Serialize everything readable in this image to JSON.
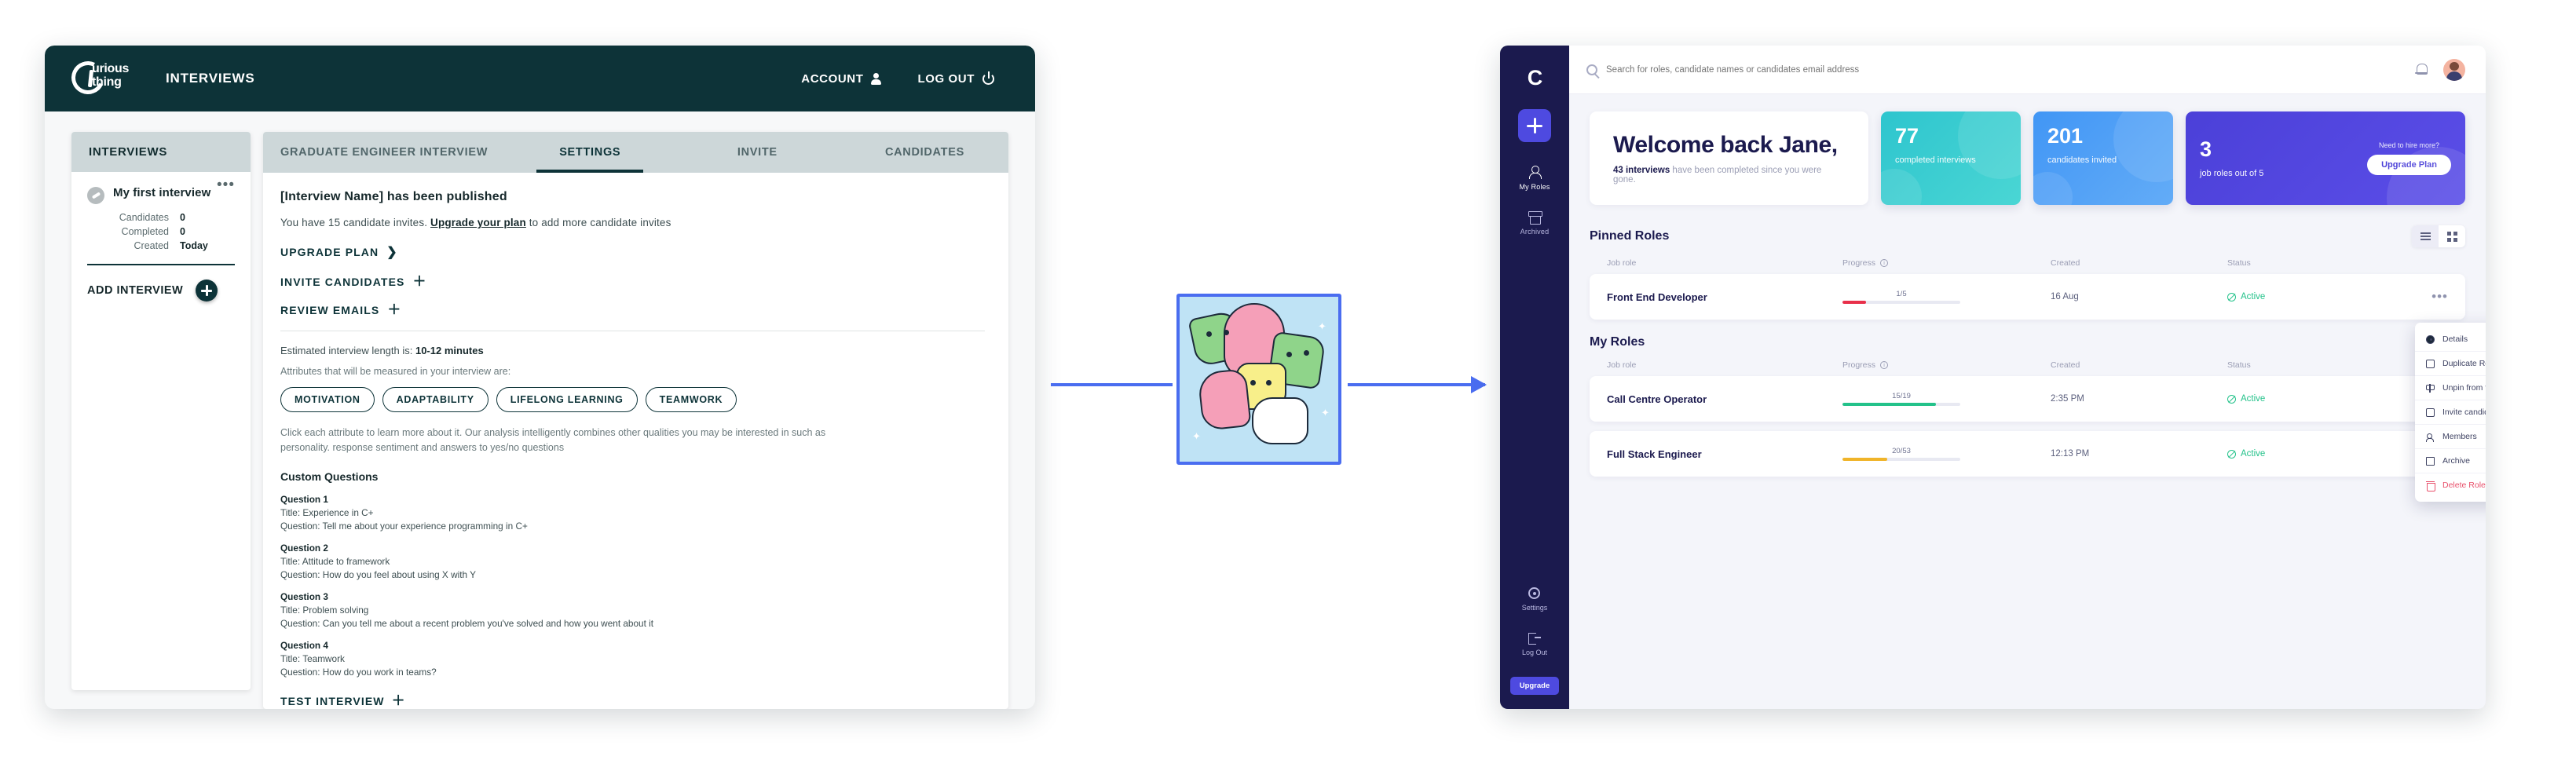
{
  "left_app": {
    "brand": {
      "line1": "urious",
      "line2": "thing"
    },
    "nav_label": "INTERVIEWS",
    "account_label": "ACCOUNT",
    "logout_label": "LOG OUT",
    "sidebar": {
      "header": "INTERVIEWS",
      "interview": {
        "title": "My first interview",
        "more_glyph": "•••",
        "meta": [
          {
            "label": "Candidates",
            "value": "0"
          },
          {
            "label": "Completed",
            "value": "0"
          },
          {
            "label": "Created",
            "value": "Today"
          }
        ]
      },
      "add_label": "ADD INTERVIEW"
    },
    "tabs": [
      {
        "label": "GRADUATE ENGINEER INTERVIEW",
        "active": false
      },
      {
        "label": "SETTINGS",
        "active": true
      },
      {
        "label": "INVITE",
        "active": false
      },
      {
        "label": "CANDIDATES",
        "active": false
      }
    ],
    "main": {
      "published_heading": "[Interview Name] has been published",
      "invites_prefix": "You have 15 candidate invites. ",
      "invites_link": "Upgrade your plan",
      "invites_suffix": " to add more candidate invites",
      "upgrade_plan_label": "UPGRADE PLAN",
      "upgrade_plan_chevron": "❯",
      "invite_candidates_label": "INVITE CANDIDATES",
      "review_emails_label": "REVIEW EMAILS",
      "plus_glyph": "＋",
      "length_prefix": "Estimated interview length is: ",
      "length_value": "10-12 minutes",
      "attributes_lead": "Attributes that will be measured in your interview are:",
      "attributes": [
        "MOTIVATION",
        "ADAPTABILITY",
        "LIFELONG LEARNING",
        "TEAMWORK"
      ],
      "attributes_note": "Click each attribute to learn more about it. Our analysis intelligently combines other qualities you may be interested in such as personality. response sentiment and answers to yes/no questions",
      "custom_questions_heading": "Custom Questions",
      "questions": [
        {
          "n": "Question 1",
          "title": "Title: Experience in C+",
          "q": "Question: Tell me about your experience programming in C+"
        },
        {
          "n": "Question 2",
          "title": "Title: Attitude to framework",
          "q": "Question: How do you feel about using X with Y"
        },
        {
          "n": "Question 3",
          "title": "Title: Problem solving",
          "q": "Question: Can you tell me about a recent problem you've solved and how you went about it"
        },
        {
          "n": "Question 4",
          "title": "Title: Teamwork",
          "q": "Question: How do you work in teams?"
        }
      ],
      "test_interview_label": "TEST INTERVIEW"
    }
  },
  "right_app": {
    "logo": "C",
    "sidebar": {
      "add_glyph": "+",
      "items": [
        {
          "label": "My Roles",
          "icon": "people-icon",
          "active": true
        },
        {
          "label": "Archived",
          "icon": "archive-icon",
          "active": false
        }
      ],
      "bottom_items": [
        {
          "label": "Settings",
          "icon": "gear-icon"
        },
        {
          "label": "Log Out",
          "icon": "logout-icon"
        }
      ],
      "upgrade_label": "Upgrade"
    },
    "topbar": {
      "search_placeholder": "Search for roles, candidate names or candidates email address"
    },
    "welcome": {
      "title": "Welcome back Jane,",
      "sub_bold": "43 interviews",
      "sub_rest": " have been completed since you were gone."
    },
    "stats": [
      {
        "num": "77",
        "label": "completed interviews",
        "color": "#2ec5ce"
      },
      {
        "num": "201",
        "label": "candidates invited",
        "color": "#4196f5"
      },
      {
        "num": "3",
        "label": "job roles out of 5",
        "color": "#4b40d8",
        "hint": "Need to hire more?",
        "cta": "Upgrade Plan"
      }
    ],
    "pinned_section": {
      "title": "Pinned Roles",
      "columns": [
        "Job role",
        "Progress",
        "Created",
        "Status"
      ],
      "rows": [
        {
          "role": "Front End Developer",
          "frac": "1/5",
          "pct": 20,
          "bar_color": "#e8304a",
          "created": "16 Aug",
          "status": "Active"
        }
      ]
    },
    "my_section": {
      "title": "My Roles",
      "columns": [
        "Job role",
        "Progress",
        "Created",
        "Status"
      ],
      "rows": [
        {
          "role": "Call Centre Operator",
          "frac": "15/19",
          "pct": 79,
          "bar_color": "#23c28a",
          "created": "2:35 PM",
          "status": "Active"
        },
        {
          "role": "Full Stack Engineer",
          "frac": "20/53",
          "pct": 38,
          "bar_color": "#f0b429",
          "created": "12:13 PM",
          "status": "Active"
        }
      ]
    },
    "context_menu": {
      "items": [
        {
          "label": "Details",
          "icon": "eye-icon",
          "danger": false
        },
        {
          "label": "Duplicate Role",
          "icon": "copy-icon",
          "danger": false
        },
        {
          "label": "Unpin from top of page",
          "icon": "pin-icon",
          "danger": false
        },
        {
          "label": "Invite candidates",
          "icon": "envelope-icon",
          "danger": false
        },
        {
          "label": "Members",
          "icon": "members-icon",
          "danger": false
        },
        {
          "label": "Archive",
          "icon": "box-icon",
          "danger": false
        },
        {
          "label": "Delete Role",
          "icon": "trash-icon",
          "danger": true
        }
      ]
    }
  }
}
